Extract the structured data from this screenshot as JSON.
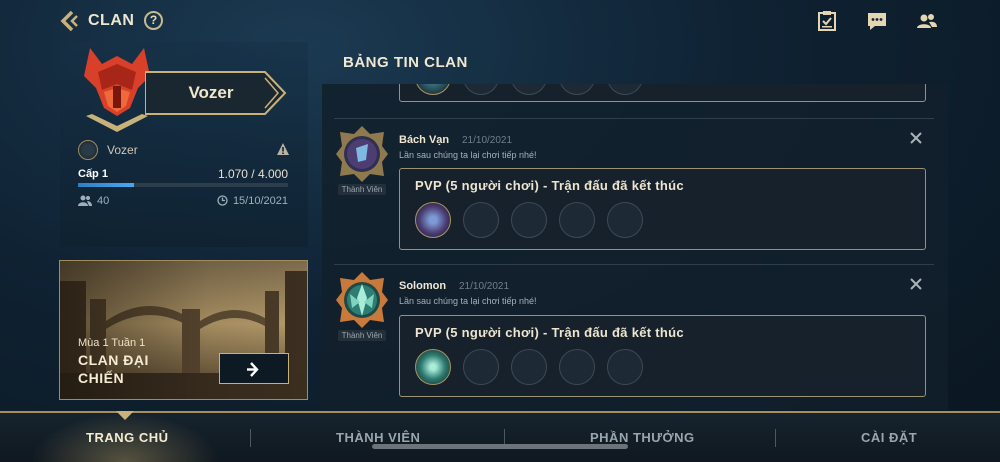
{
  "header": {
    "title": "CLAN",
    "help_label": "?"
  },
  "clan": {
    "name": "Vozer",
    "owner": "Vozer",
    "level_label": "Cấp 1",
    "xp_text": "1.070 / 4.000",
    "xp_fraction": 0.2675,
    "members": "40",
    "created": "15/10/2021"
  },
  "season": {
    "week": "Mùa 1 Tuần 1",
    "title_line1": "CLAN ĐẠI",
    "title_line2": "CHIẾN"
  },
  "feed": {
    "title": "BẢNG TIN CLAN",
    "posts": [
      {
        "author": "Bách Vạn",
        "date": "21/10/2021",
        "message": "Lần sau chúng ta lại chơi tiếp nhé!",
        "role": "Thành Viên",
        "match_title": "PVP (5 người chơi) - Trận đấu đã kết thúc"
      },
      {
        "author": "Solomon",
        "date": "21/10/2021",
        "message": "Lần sau chúng ta lại chơi tiếp nhé!",
        "role": "Thành Viên",
        "match_title": "PVP (5 người chơi) - Trận đấu đã kết thúc"
      }
    ]
  },
  "nav": {
    "items": [
      "TRANG CHỦ",
      "THÀNH VIÊN",
      "PHẦN THƯỞNG",
      "CÀI ĐẶT"
    ],
    "active": "TRANG CHỦ"
  },
  "icons": {
    "back": "back-chevron-icon",
    "help": "help-icon",
    "missions": "clipboard-check-icon",
    "chat": "chat-icon",
    "friends": "friends-icon",
    "warn": "warning-icon",
    "members": "people-icon",
    "clock": "clock-icon",
    "close": "close-icon",
    "arrow": "arrow-right-icon"
  },
  "colors": {
    "accent_gold": "#c8b27a",
    "xp_bar": "#2f7ec4",
    "clan_emblem": "#e0452a"
  }
}
